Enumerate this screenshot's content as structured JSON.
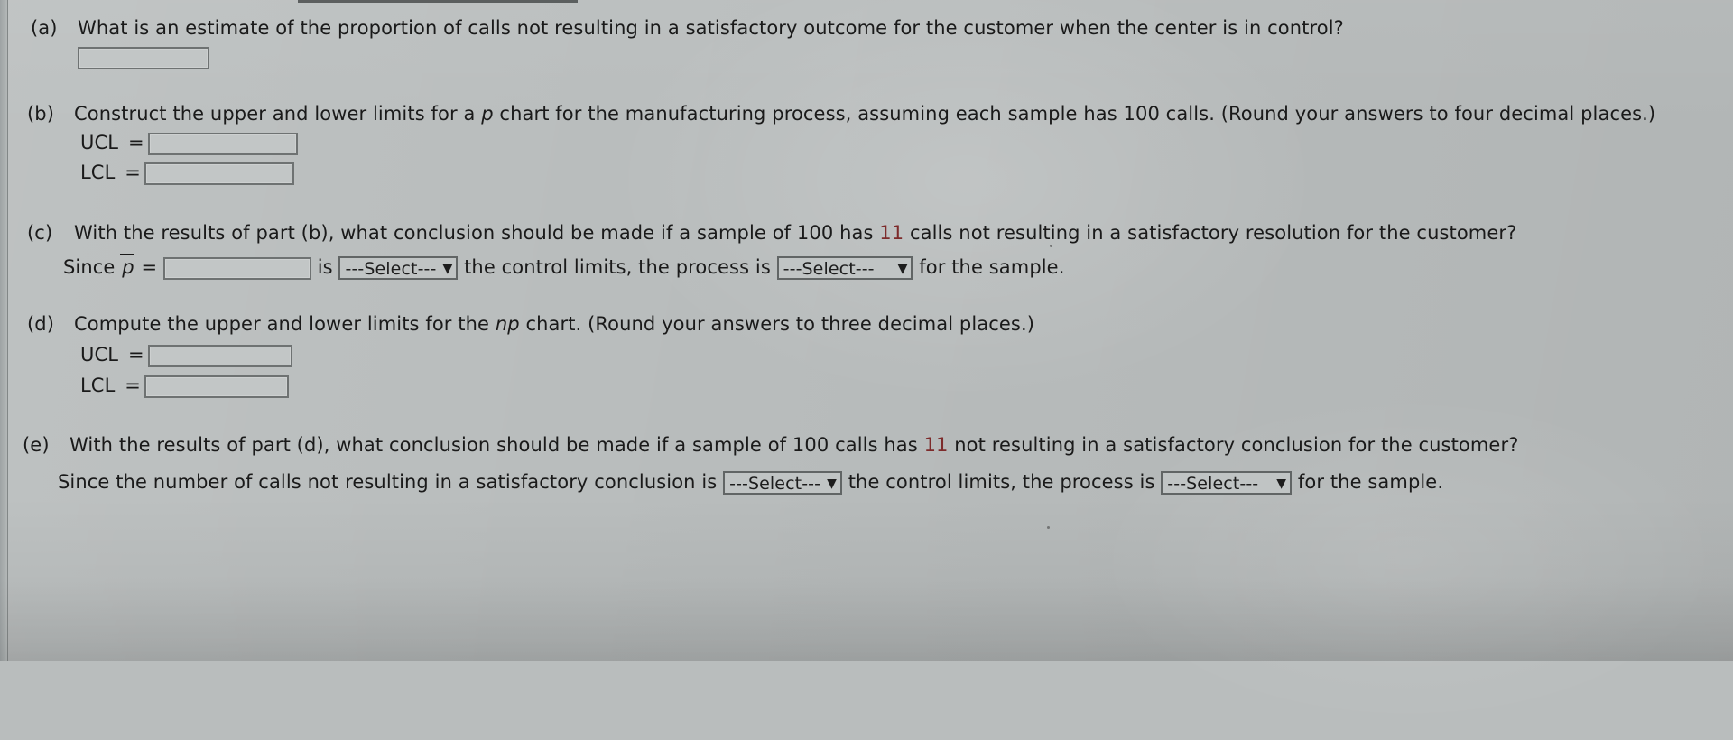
{
  "document": {
    "type": "homework-question",
    "background_color": "#b9bdbd",
    "accent_number_color": "#7d2b2b"
  },
  "questions": [
    {
      "id": "a",
      "label": "(a)",
      "prompt": "What is an estimate of the proportion of calls not resulting in a satisfactory outcome for the customer when the center is in control?",
      "inputs": [
        {
          "name": "part-a-answer",
          "value": "",
          "placeholder": ""
        }
      ]
    },
    {
      "id": "b",
      "label": "(b)",
      "prompt_pre": "Construct the upper and lower limits for a ",
      "prompt_italic": "p",
      "prompt_post": " chart for the manufacturing process, assuming each sample has 100 calls. (Round your answers to four decimal places.)",
      "fields": [
        {
          "name": "part-b-ucl",
          "label": "UCL",
          "equals": "=",
          "value": ""
        },
        {
          "name": "part-b-lcl",
          "label": "LCL",
          "equals": "=",
          "value": ""
        }
      ]
    },
    {
      "id": "c",
      "label": "(c)",
      "prompt_pre": "With the results of part (b), what conclusion should be made if a sample of 100 has ",
      "prompt_number": "11",
      "prompt_post": " calls not resulting in a satisfactory resolution for the customer?",
      "sentence": {
        "lead": "Since",
        "symbol": "p",
        "equals": "=",
        "input_name": "part-c-pbar",
        "input_value": "",
        "mid1": "is",
        "select1_value": "---Select---",
        "mid2": "the control limits, the process is",
        "select2_value": "---Select---",
        "tail": "for the sample."
      }
    },
    {
      "id": "d",
      "label": "(d)",
      "prompt_pre": "Compute the upper and lower limits for the ",
      "prompt_italic": "np",
      "prompt_post": " chart. (Round your answers to three decimal places.)",
      "fields": [
        {
          "name": "part-d-ucl",
          "label": "UCL",
          "equals": "=",
          "value": ""
        },
        {
          "name": "part-d-lcl",
          "label": "LCL",
          "equals": "=",
          "value": ""
        }
      ]
    },
    {
      "id": "e",
      "label": "(e)",
      "prompt_pre": "With the results of part (d), what conclusion should be made if a sample of 100 calls has ",
      "prompt_number": "11",
      "prompt_post": " not resulting in a satisfactory conclusion for the customer?",
      "sentence": {
        "lead": "Since the number of calls not resulting in a satisfactory conclusion is",
        "select1_value": "---Select---",
        "mid": "the control limits, the process is",
        "select2_value": "---Select---",
        "tail": "for the sample."
      }
    }
  ],
  "icons": {
    "dropdown_caret": "▼"
  }
}
